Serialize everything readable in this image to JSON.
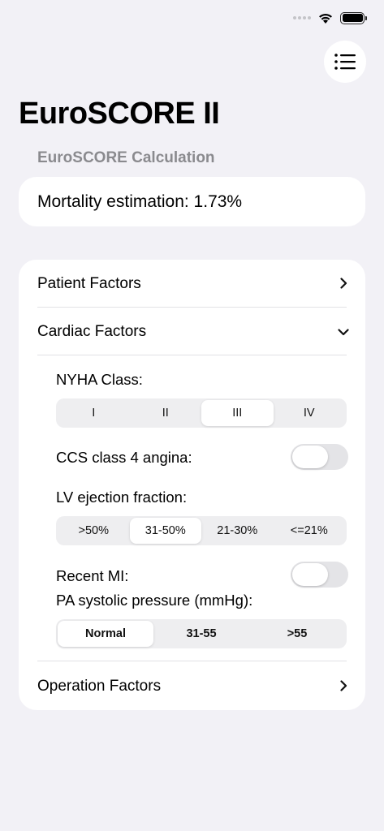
{
  "app": {
    "title": "EuroSCORE II",
    "section_header": "EuroSCORE Calculation"
  },
  "mortality": {
    "label": "Mortality estimation: 1.73%"
  },
  "sections": {
    "patient": {
      "label": "Patient Factors"
    },
    "cardiac": {
      "label": "Cardiac Factors"
    },
    "operation": {
      "label": "Operation Factors"
    }
  },
  "cardiac": {
    "nyha": {
      "label": "NYHA Class:",
      "options": [
        "I",
        "II",
        "III",
        "IV"
      ],
      "selected": "III"
    },
    "ccs": {
      "label": "CCS class 4 angina:",
      "value": false
    },
    "lvef": {
      "label": "LV ejection fraction:",
      "options": [
        ">50%",
        "31-50%",
        "21-30%",
        "<=21%"
      ],
      "selected": "31-50%"
    },
    "recent_mi": {
      "label": "Recent MI:",
      "value": false
    },
    "pa_pressure": {
      "label": "PA systolic pressure (mmHg):",
      "options": [
        "Normal",
        "31-55",
        ">55"
      ],
      "selected": "Normal"
    }
  },
  "icons": {
    "menu": "list-icon",
    "chevron_right": "chevron-right-icon",
    "chevron_down": "chevron-down-icon"
  },
  "colors": {
    "background": "#f2f1f6",
    "card": "#ffffff",
    "secondary_text": "#8a8a8e"
  }
}
